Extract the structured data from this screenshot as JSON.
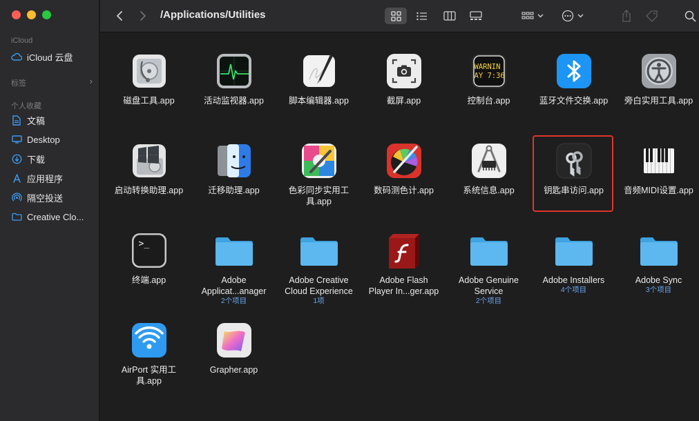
{
  "sidebar": {
    "sections": [
      {
        "label": "iCloud"
      },
      {
        "label": "标签"
      },
      {
        "label": "个人收藏"
      }
    ],
    "icloud_items": [
      {
        "label": "iCloud 云盘",
        "icon": "cloud-icon"
      }
    ],
    "favorites": [
      {
        "label": "文稿",
        "icon": "document-icon"
      },
      {
        "label": "Desktop",
        "icon": "desktop-icon"
      },
      {
        "label": "下载",
        "icon": "download-icon"
      },
      {
        "label": "应用程序",
        "icon": "applications-icon"
      },
      {
        "label": "隔空投送",
        "icon": "airdrop-icon"
      },
      {
        "label": "Creative Clo...",
        "icon": "folder-icon"
      }
    ]
  },
  "toolbar": {
    "title": "/Applications/Utilities",
    "view_mode": "icon"
  },
  "colors": {
    "accent": "#1c95f5",
    "highlight_border": "#e0352b",
    "folder": "#5cb8ee",
    "subtitle": "#6aa8f0"
  },
  "items": [
    {
      "label": "磁盘工具.app",
      "sub": "",
      "icon": "disk-utility-icon"
    },
    {
      "label": "活动监视器.app",
      "sub": "",
      "icon": "activity-monitor-icon"
    },
    {
      "label": "脚本编辑器.app",
      "sub": "",
      "icon": "script-editor-icon"
    },
    {
      "label": "截屏.app",
      "sub": "",
      "icon": "screenshot-icon"
    },
    {
      "label": "控制台.app",
      "sub": "",
      "icon": "console-icon",
      "console_text": "WARNIN\nAY 7:36"
    },
    {
      "label": "蓝牙文件交换.app",
      "sub": "",
      "icon": "bluetooth-icon"
    },
    {
      "label": "旁白实用工具.app",
      "sub": "",
      "icon": "voiceover-icon"
    },
    {
      "label": "启动转换助理.app",
      "sub": "",
      "icon": "boot-camp-icon"
    },
    {
      "label": "迁移助理.app",
      "sub": "",
      "icon": "migration-assistant-icon"
    },
    {
      "label": "色彩同步实用工\n具.app",
      "sub": "",
      "icon": "colorsync-icon"
    },
    {
      "label": "数码测色计.app",
      "sub": "",
      "icon": "digital-color-meter-icon"
    },
    {
      "label": "系统信息.app",
      "sub": "",
      "icon": "system-information-icon"
    },
    {
      "label": "钥匙串访问.app",
      "sub": "",
      "icon": "keychain-access-icon",
      "selected": true
    },
    {
      "label": "音频MIDI设置.app",
      "sub": "",
      "icon": "audio-midi-icon"
    },
    {
      "label": "终端.app",
      "sub": "",
      "icon": "terminal-icon",
      "terminal_text": ">_"
    },
    {
      "label": "Adobe\nApplicat...anager",
      "sub": "2个项目",
      "icon": "folder-icon"
    },
    {
      "label": "Adobe Creative\nCloud Experience",
      "sub": "1项",
      "icon": "folder-icon"
    },
    {
      "label": "Adobe Flash\nPlayer In...ger.app",
      "sub": "",
      "icon": "flash-player-icon"
    },
    {
      "label": "Adobe Genuine\nService",
      "sub": "2个项目",
      "icon": "folder-icon"
    },
    {
      "label": "Adobe Installers",
      "sub": "4个项目",
      "icon": "folder-icon"
    },
    {
      "label": "Adobe Sync",
      "sub": "3个项目",
      "icon": "folder-icon"
    },
    {
      "label": "AirPort 实用工\n具.app",
      "sub": "",
      "icon": "airport-utility-icon"
    },
    {
      "label": "Grapher.app",
      "sub": "",
      "icon": "grapher-icon"
    }
  ]
}
